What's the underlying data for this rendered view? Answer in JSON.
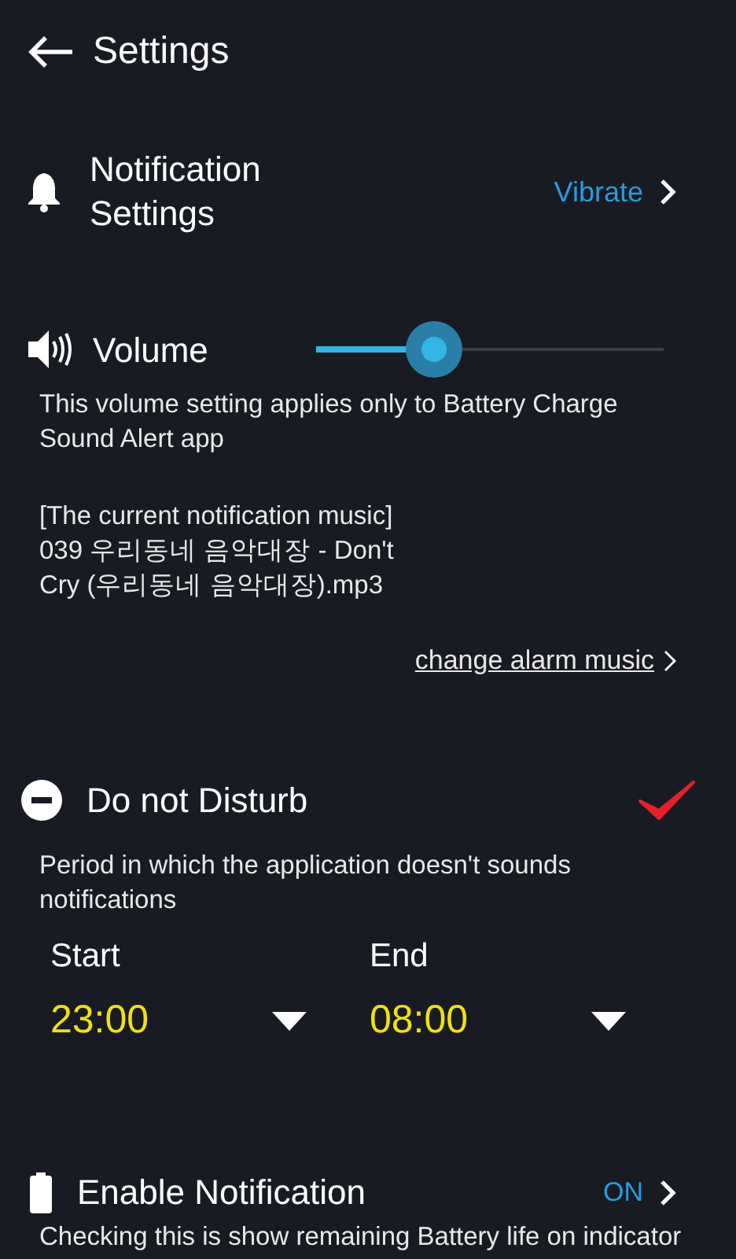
{
  "header": {
    "title": "Settings"
  },
  "notification_settings": {
    "label": "Notification\nSettings",
    "value": "Vibrate"
  },
  "volume": {
    "label": "Volume",
    "level": 0.34,
    "description": "This volume setting applies only to Battery Charge Sound Alert app"
  },
  "current_music": {
    "heading": "[The current notification music]",
    "file": "039 우리동네 음악대장 - Don't Cry (우리동네 음악대장).mp3",
    "link": "change alarm music"
  },
  "do_not_disturb": {
    "label": "Do not Disturb",
    "checked": true,
    "description": "Period in which the application doesn't sounds notifications",
    "times": [
      {
        "label": "Start",
        "value": "23:00"
      },
      {
        "label": "End",
        "value": "08:00"
      }
    ]
  },
  "enable_notification": {
    "label": "Enable Notification",
    "value": "ON",
    "description": "Checking this is show remaining Battery life on indicator"
  }
}
